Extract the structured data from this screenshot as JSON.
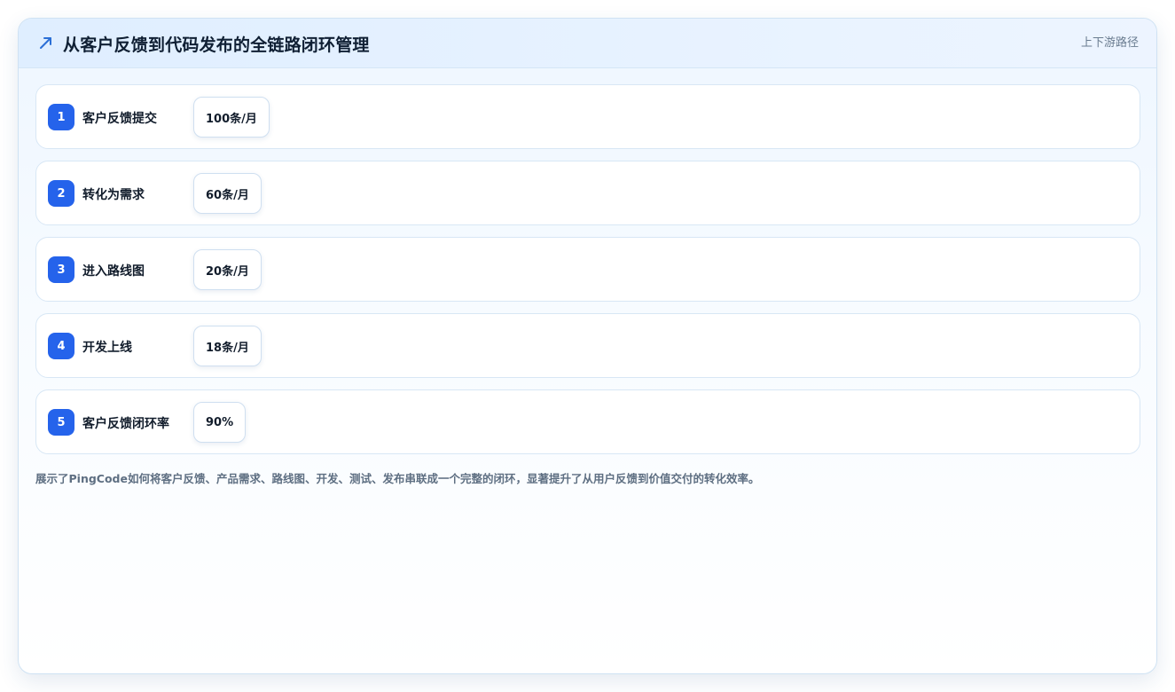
{
  "header": {
    "icon": "trend-arrow-icon",
    "title": "从客户反馈到代码发布的全链路闭环管理",
    "tag": "上下游路径"
  },
  "steps": [
    {
      "number": "1",
      "label": "客户反馈提交",
      "metric": "100条/月"
    },
    {
      "number": "2",
      "label": "转化为需求",
      "metric": "60条/月"
    },
    {
      "number": "3",
      "label": "进入路线图",
      "metric": "20条/月"
    },
    {
      "number": "4",
      "label": "开发上线",
      "metric": "18条/月"
    },
    {
      "number": "5",
      "label": "客户反馈闭环率",
      "metric": "90%"
    }
  ],
  "description": "展示了PingCode如何将客户反馈、产品需求、路线图、开发、测试、发布串联成一个完整的闭环，显著提升了从用户反馈到价值交付的转化效率。",
  "colors": {
    "accent": "#2563eb",
    "header_bg": "#e3f0ff"
  }
}
